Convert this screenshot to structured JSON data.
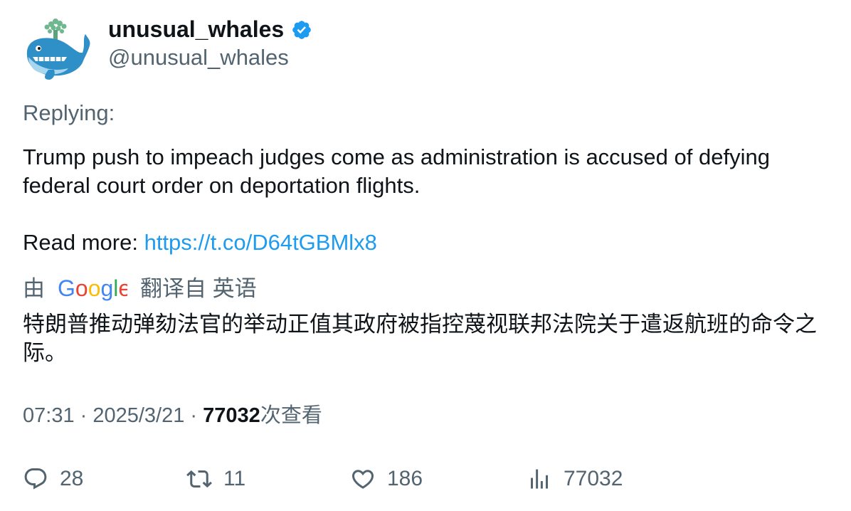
{
  "author": {
    "display_name": "unusual_whales",
    "handle": "@unusual_whales",
    "verified_icon": "verified-badge-icon",
    "avatar_icon": "whale-avatar-icon",
    "verified_color": "#1d9bf0"
  },
  "replying_label": "Replying:",
  "body": {
    "line1": "Trump push to impeach judges come as administration is accused of defying federal court order on deportation flights.",
    "read_more_label": "Read more: ",
    "link_text": "https://t.co/D64tGBMlx8"
  },
  "translation": {
    "by_label": "由",
    "provider": "Google",
    "from_label": "翻译自 英语",
    "text": "特朗普推动弹劾法官的举动正值其政府被指控蔑视联邦法院关于遣返航班的命令之际。"
  },
  "meta": {
    "time": "07:31",
    "separator": " · ",
    "date": "2025/3/21",
    "views_count": "77032",
    "views_label": "次查看"
  },
  "actions": {
    "replies": "28",
    "retweets": "11",
    "likes": "186",
    "views": "77032"
  },
  "colors": {
    "text_primary": "#0f1419",
    "text_secondary": "#536471",
    "link": "#1d9bf0"
  }
}
